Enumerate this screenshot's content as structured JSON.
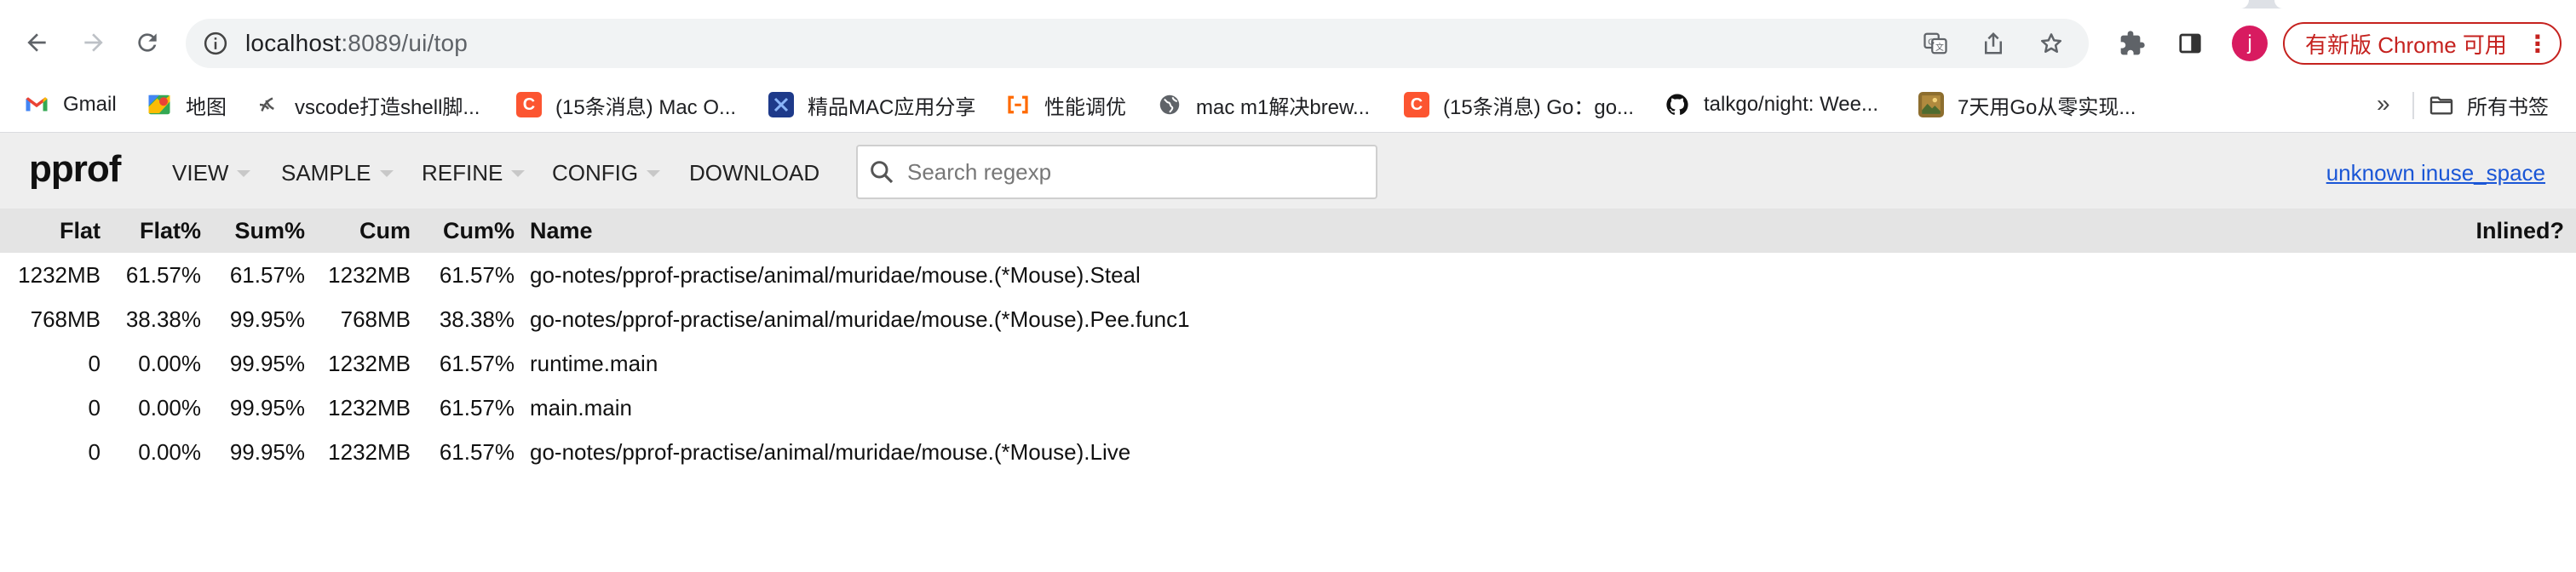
{
  "browser": {
    "url_host": "localhost",
    "url_rest": ":8089/ui/top",
    "avatar_letter": "j",
    "update_button": "有新版 Chrome 可用",
    "icons": [
      "back-arrow-icon",
      "forward-arrow-icon",
      "reload-icon",
      "info-icon",
      "translate-icon",
      "share-icon",
      "star-icon",
      "extensions-icon",
      "side-panel-icon",
      "more-vert-icon"
    ]
  },
  "bookmarks": {
    "items": [
      {
        "label": "Gmail",
        "icon": "gmail-icon",
        "color": "#ea4335"
      },
      {
        "label": "地图",
        "icon": "maps-icon",
        "color": "#34a853"
      },
      {
        "label": "vscode打造shell脚...",
        "icon": "vscode-bookmark-icon",
        "color": "#555555"
      },
      {
        "label": "(15条消息) Mac O...",
        "icon": "csdn-icon",
        "color": "#fc5531"
      },
      {
        "label": "精品MAC应用分享",
        "icon": "xclose-icon",
        "color": "#1a73e8"
      },
      {
        "label": "性能调优",
        "icon": "bracket-icon",
        "color": "#ff6a00"
      },
      {
        "label": "mac m1解决brew...",
        "icon": "globe-icon",
        "color": "#5f6368"
      },
      {
        "label": "(15条消息) Go：go...",
        "icon": "csdn-icon",
        "color": "#fc5531"
      },
      {
        "label": "talkgo/night: Wee...",
        "icon": "github-icon",
        "color": "#111111"
      },
      {
        "label": "7天用Go从零实现...",
        "icon": "image-bookmark-icon",
        "color": "#8d6e2f"
      }
    ],
    "more": "»",
    "folder_label": "所有书签"
  },
  "pprof": {
    "logo": "pprof",
    "menus": [
      "VIEW",
      "SAMPLE",
      "REFINE",
      "CONFIG",
      "DOWNLOAD"
    ],
    "search_placeholder": "Search regexp",
    "right_link": "unknown inuse_space"
  },
  "table": {
    "headers": [
      "Flat",
      "Flat%",
      "Sum%",
      "Cum",
      "Cum%",
      "Name",
      "Inlined?"
    ],
    "rows": [
      [
        "1232MB",
        "61.57%",
        "61.57%",
        "1232MB",
        "61.57%",
        "go-notes/pprof-practise/animal/muridae/mouse.(*Mouse).Steal",
        ""
      ],
      [
        "768MB",
        "38.38%",
        "99.95%",
        "768MB",
        "38.38%",
        "go-notes/pprof-practise/animal/muridae/mouse.(*Mouse).Pee.func1",
        ""
      ],
      [
        "0",
        "0.00%",
        "99.95%",
        "1232MB",
        "61.57%",
        "runtime.main",
        ""
      ],
      [
        "0",
        "0.00%",
        "99.95%",
        "1232MB",
        "61.57%",
        "main.main",
        ""
      ],
      [
        "0",
        "0.00%",
        "99.95%",
        "1232MB",
        "61.57%",
        "go-notes/pprof-practise/animal/muridae/mouse.(*Mouse).Live",
        ""
      ]
    ]
  }
}
